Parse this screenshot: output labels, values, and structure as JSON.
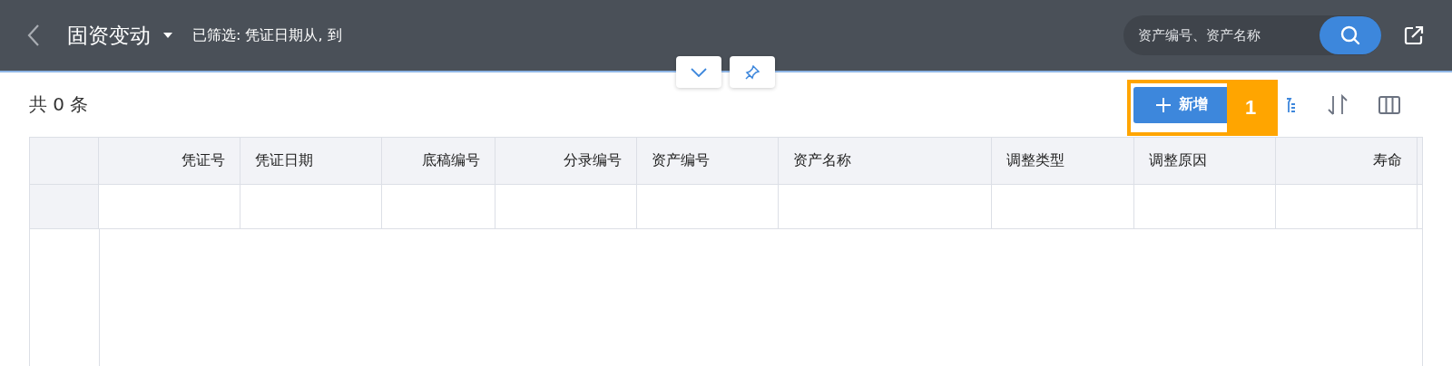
{
  "header": {
    "title": "固资变动",
    "filter_summary": "已筛选: 凭证日期从, 到",
    "search": {
      "placeholder": "资产编号、资产名称"
    }
  },
  "record_count": "共 0 条",
  "toolbar": {
    "add_button": "新增"
  },
  "annotation": {
    "number": "1"
  },
  "table": {
    "columns": [
      {
        "label": "凭证号"
      },
      {
        "label": "凭证日期"
      },
      {
        "label": "底稿编号"
      },
      {
        "label": "分录编号"
      },
      {
        "label": "资产编号"
      },
      {
        "label": "资产名称"
      },
      {
        "label": "调整类型"
      },
      {
        "label": "调整原因"
      },
      {
        "label": "寿命"
      }
    ]
  }
}
